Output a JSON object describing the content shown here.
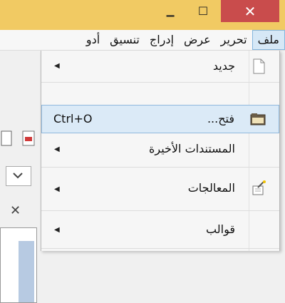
{
  "window": {
    "minimize_glyph": "▁",
    "maximize_glyph": "☐",
    "close_glyph": "✕",
    "accent_color": "#f1ca63",
    "close_color": "#c94c4c"
  },
  "menubar": {
    "items": [
      {
        "label": "ملف"
      },
      {
        "label": "تحرير"
      },
      {
        "label": "عرض"
      },
      {
        "label": "إدراج"
      },
      {
        "label": "تنسيق"
      },
      {
        "label": "أدو"
      }
    ]
  },
  "dropdown": {
    "items": [
      {
        "label": "جديد",
        "arrow": "◀",
        "icon": "new-document-icon"
      },
      {
        "label": "فتح...",
        "shortcut": "Ctrl+O",
        "icon": "folder-icon",
        "highlighted": true
      },
      {
        "label": "المستندات الأخيرة",
        "arrow": "◀"
      },
      {
        "label": "المعالجات",
        "arrow": "◀",
        "icon": "wizard-icon"
      },
      {
        "label": "قوالب",
        "arrow": "◀"
      }
    ]
  },
  "background": {
    "close_glyph": "✕"
  }
}
